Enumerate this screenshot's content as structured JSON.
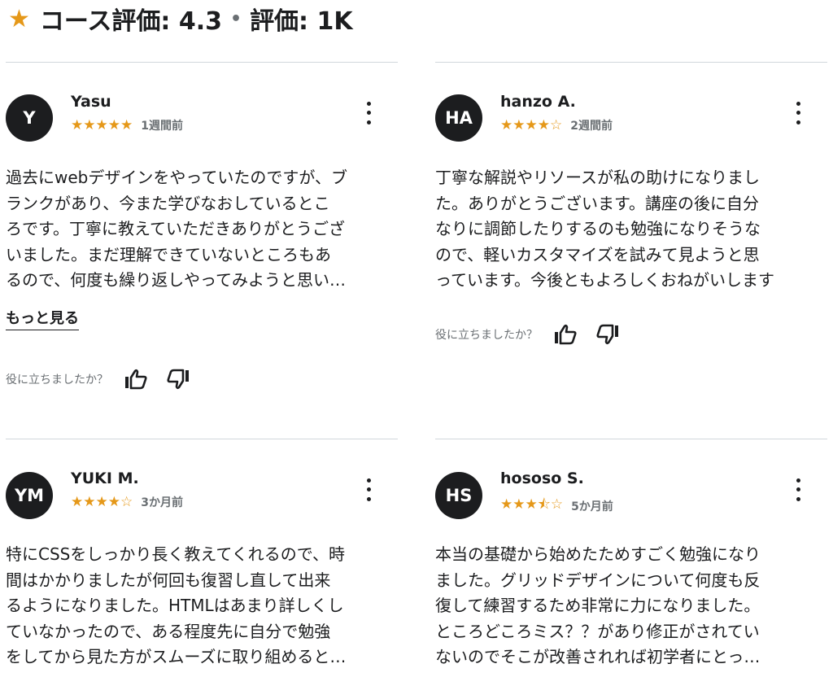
{
  "header": {
    "star_icon": "star-icon",
    "rating_label": "コース評価: 4.3",
    "separator": "•",
    "count_label": "評価: 1K"
  },
  "colors": {
    "star": "#e59819",
    "avatar_bg": "#1c1d1f",
    "muted": "#6a6f73",
    "divider": "#d1d7dc"
  },
  "reviews": [
    {
      "initials": "Y",
      "name": "Yasu",
      "rating": 5,
      "stars": "★★★★★",
      "time": "1週間前",
      "lines": [
        "過去にwebデザインをやっていたのですが、ブ",
        "ランクがあり、今また学びなおしているとこ",
        "ろです。丁寧に教えていただきありがとうござ",
        "いました。まだ理解できていないところもあ",
        "るので、何度も繰り返しやってみようと思い…"
      ],
      "more_label": "もっと見る",
      "helpful_label": "役に立ちましたか？"
    },
    {
      "initials": "HA",
      "name": "hanzo A.",
      "rating": 4,
      "stars": "★★★★☆",
      "time": "2週間前",
      "lines": [
        "丁寧な解説やリソースが私の助けになりまし",
        "た。ありがとうございます。講座の後に自分",
        "なりに調節したりするのも勉強になりそうな",
        "ので、軽いカスタマイズを試みて見ようと思",
        "っています。今後ともよろしくおねがいします"
      ],
      "helpful_label": "役に立ちましたか？"
    },
    {
      "initials": "YM",
      "name": "YUKI M.",
      "rating": 4,
      "stars": "★★★★☆",
      "time": "3か月前",
      "lines": [
        "特にCSSをしっかり長く教えてくれるので、時",
        "間はかかりましたが何回も復習し直して出来",
        "るようになりました。HTMLはあまり詳しくし",
        "ていなかったので、ある程度先に自分で勉強",
        "をしてから見た方がスムーズに取り組めると…"
      ]
    },
    {
      "initials": "HS",
      "name": "hososo S.",
      "rating": 3.5,
      "stars": "★★★⯪☆",
      "time": "5か月前",
      "lines": [
        "本当の基礎から始めたためすごく勉強になり",
        "ました。グリッドデザインについて何度も反",
        "復して練習するため非常に力になりました。",
        "ところどころミス？？があり修正がされてい",
        "ないのでそこが改善されれば初学者にとっ…"
      ]
    }
  ]
}
